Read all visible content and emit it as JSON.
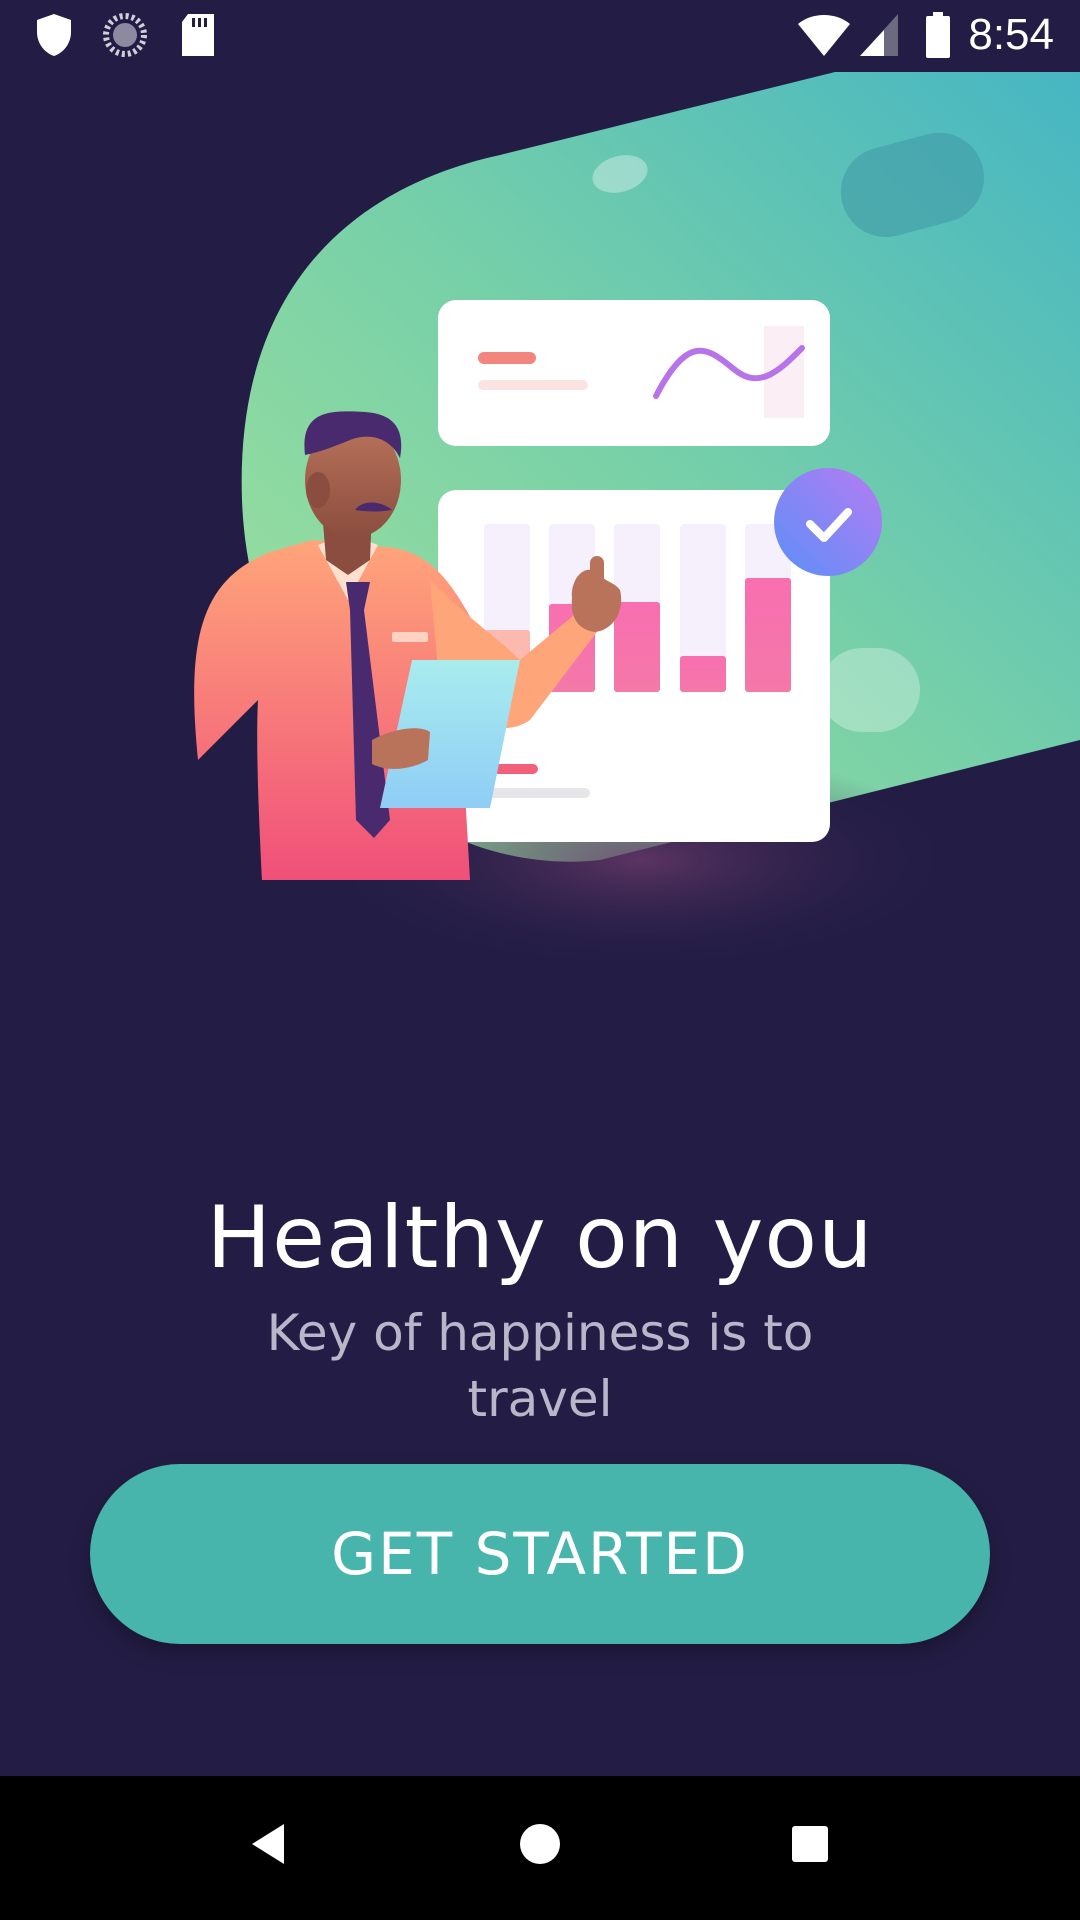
{
  "status_bar": {
    "time": "8:54",
    "left_icons": [
      "shield-icon",
      "sync-icon",
      "sd-card-icon"
    ],
    "right_icons": [
      "wifi-icon",
      "cellular-signal-icon",
      "battery-icon"
    ]
  },
  "onboarding": {
    "title": "Healthy on you",
    "subtitle": "Key of happiness is to travel",
    "cta_label": "GET STARTED"
  },
  "colors": {
    "background": "#231d45",
    "accent": "#47b5ab",
    "subtitle_text": "#b9b6c9"
  },
  "nav_bar": {
    "buttons": [
      "back-icon",
      "home-icon",
      "recents-icon"
    ]
  }
}
